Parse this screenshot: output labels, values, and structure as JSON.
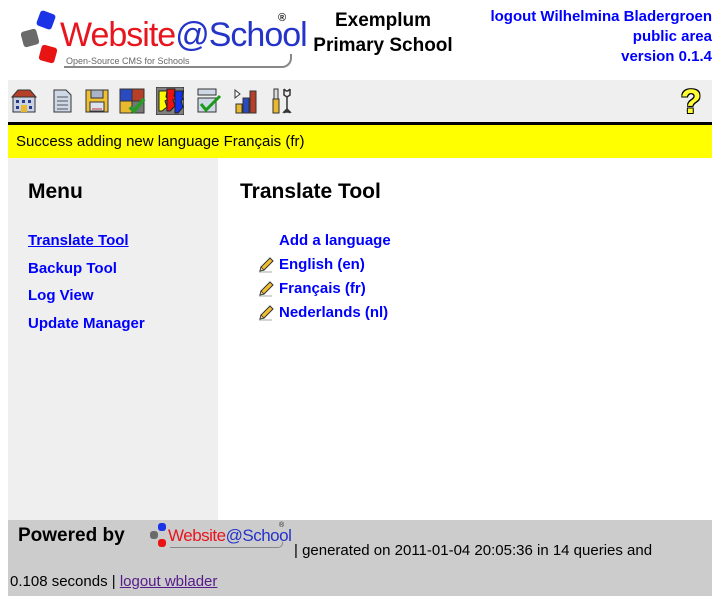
{
  "header": {
    "logo_text_red": "Website",
    "logo_text_blue": "@School",
    "logo_registered": "®",
    "logo_tagline": "Open-Source CMS for Schools",
    "site_title_line1": "Exemplum",
    "site_title_line2": "Primary School",
    "logout_link": "logout Wilhelmina Bladergroen",
    "public_area_link": "public area",
    "version_link": "version 0.1.4"
  },
  "toolbar": {
    "icons": [
      {
        "name": "start-center-icon"
      },
      {
        "name": "page-manager-icon"
      },
      {
        "name": "file-manager-icon"
      },
      {
        "name": "modules-icon"
      },
      {
        "name": "account-manager-icon"
      },
      {
        "name": "configuration-manager-icon"
      },
      {
        "name": "statistics-icon"
      },
      {
        "name": "tools-icon"
      }
    ],
    "help_icon": "help-icon",
    "help_glyph": "?"
  },
  "message": {
    "text": "Success adding new language Français (fr)",
    "color": "#ffff00"
  },
  "menu": {
    "title": "Menu",
    "items": [
      {
        "label": "Translate Tool",
        "active": true
      },
      {
        "label": "Backup Tool",
        "active": false
      },
      {
        "label": "Log View",
        "active": false
      },
      {
        "label": "Update Manager",
        "active": false
      }
    ]
  },
  "content": {
    "title": "Translate Tool",
    "add_link": "Add a language",
    "languages": [
      {
        "label": "English (en)",
        "icon": "pencil-icon"
      },
      {
        "label": "Français (fr)",
        "icon": "pencil-icon"
      },
      {
        "label": "Nederlands (nl)",
        "icon": "pencil-icon"
      }
    ]
  },
  "footer": {
    "powered_by": "Powered by",
    "logo_text_red": "Website",
    "logo_text_blue": "@School",
    "logo_registered": "®",
    "generated_text": "| generated on 2011-01-04 20:05:36 in 14 queries and",
    "seconds_text": "0.108 seconds | ",
    "logout_link": "logout wblader"
  },
  "colors": {
    "link": "#0000ff",
    "visited_link": "#551a8b",
    "message_bg": "#ffff00",
    "menu_bg": "#efefef",
    "footer_bg": "#cccccc"
  }
}
